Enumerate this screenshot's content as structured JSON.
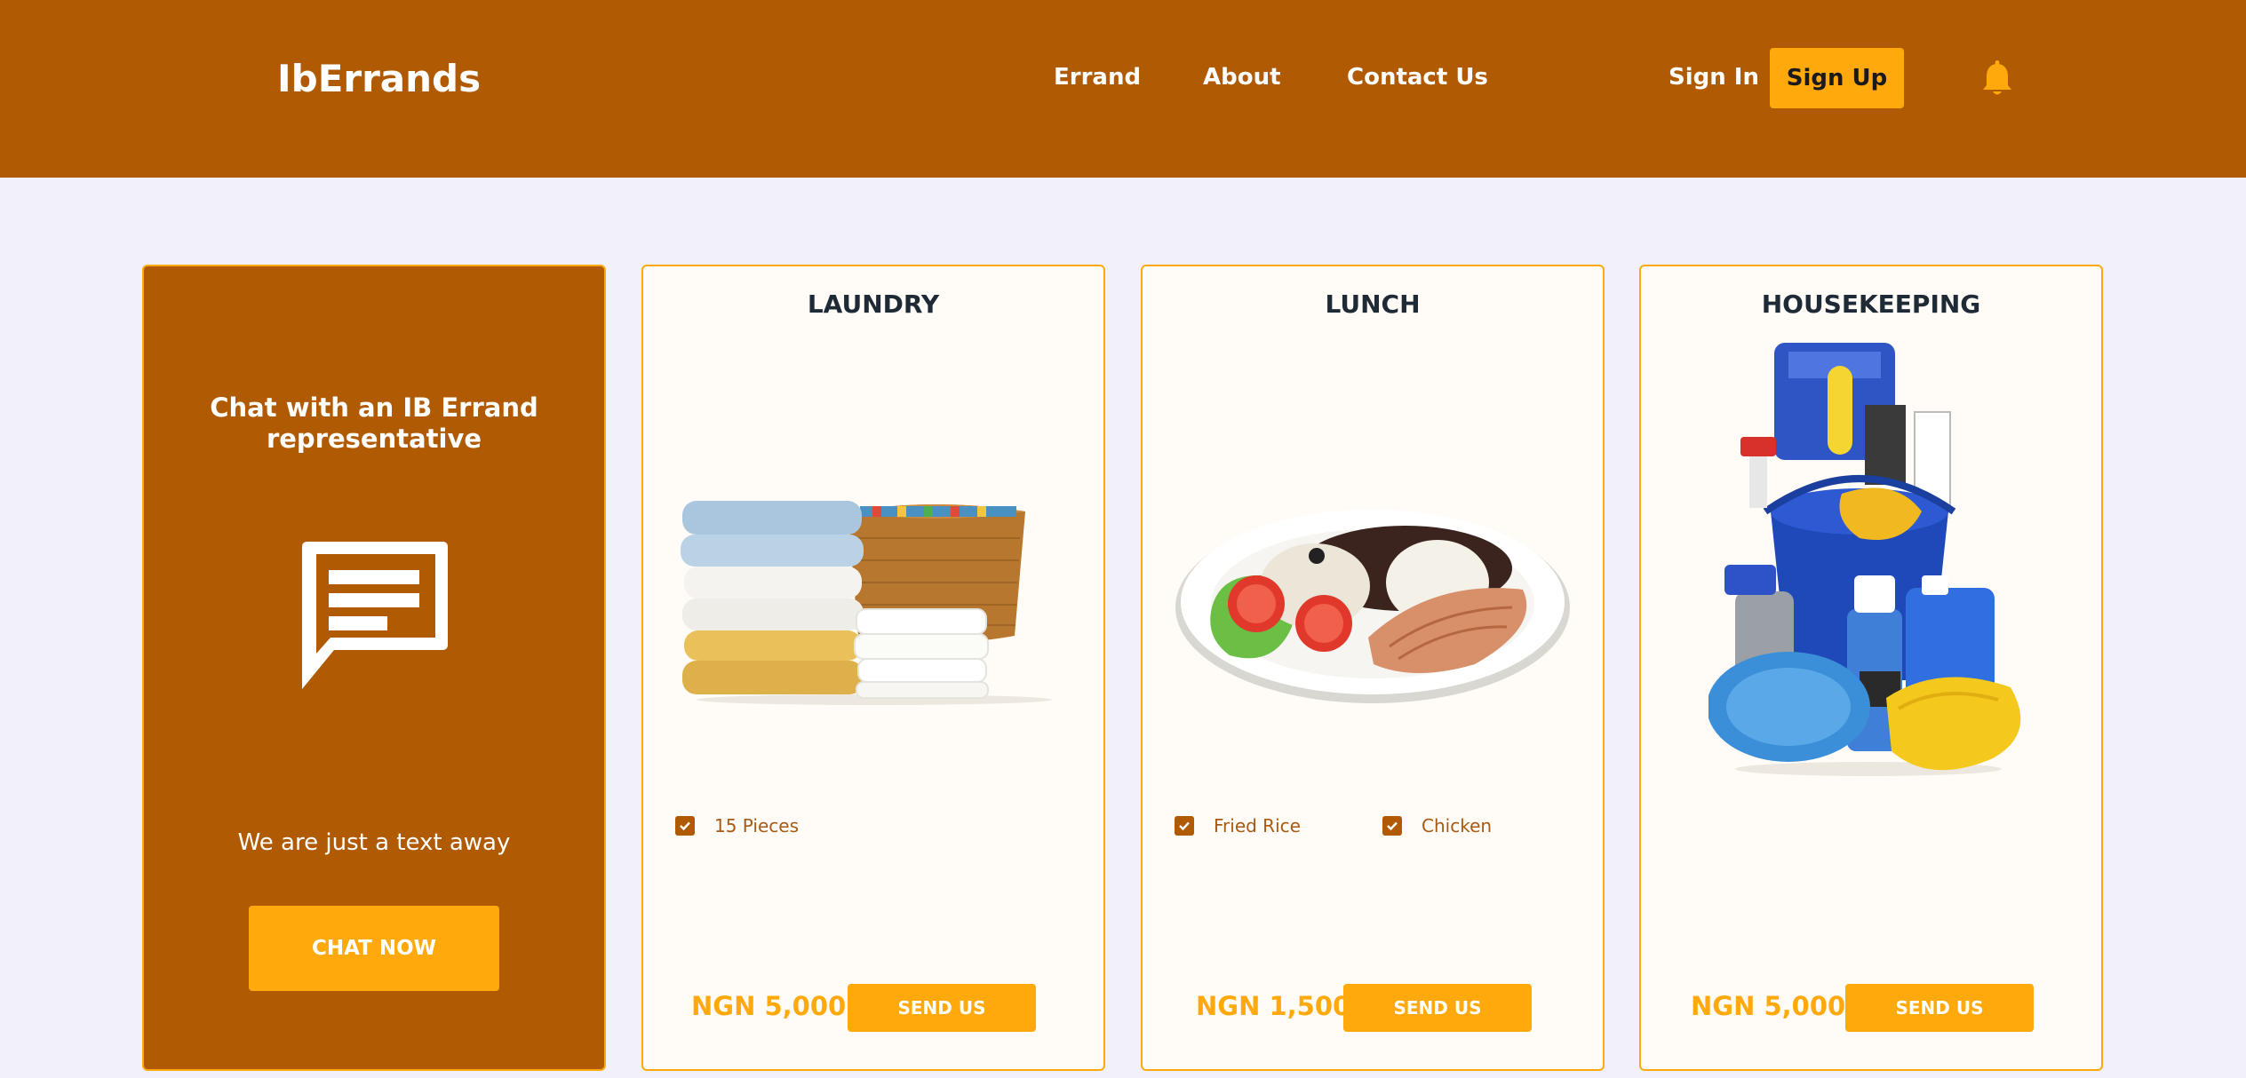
{
  "header": {
    "brand": "IbErrands",
    "nav": [
      "Errand",
      "About",
      "Contact Us"
    ],
    "sign_in": "Sign In",
    "sign_up": "Sign Up",
    "bell_icon": "bell-icon"
  },
  "chat_card": {
    "title": "Chat with an IB Errand representative",
    "icon": "chat-message-icon",
    "subtitle": "We are just a text away",
    "button": "CHAT NOW"
  },
  "services": [
    {
      "title": "LAUNDRY",
      "options": [
        "15 Pieces"
      ],
      "price": "NGN 5,000",
      "button": "SEND US"
    },
    {
      "title": "LUNCH",
      "options": [
        "Fried Rice",
        "Chicken"
      ],
      "price": "NGN 1,500",
      "button": "SEND US"
    },
    {
      "title": "HOUSEKEEPING",
      "options": [],
      "price": "NGN 5,000",
      "button": "SEND US"
    }
  ],
  "colors": {
    "brand_brown": "#b05b04",
    "accent_orange": "#ffa90d",
    "page_bg": "#f1f0fb",
    "card_bg": "#fffcf7"
  }
}
